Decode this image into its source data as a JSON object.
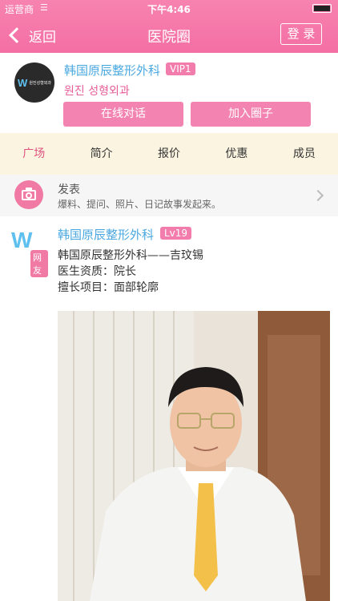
{
  "status_bar": {
    "carrier": "运营商",
    "time": "下午4:46"
  },
  "nav": {
    "back_label": "返回",
    "title": "医院圈",
    "login_label": "登 录"
  },
  "hospital": {
    "name": "韩国原辰整形外科",
    "vip_badge": "VIP1",
    "subtitle": "원진 성형외과",
    "logo_text": "W",
    "logo_small": "원진성형외과",
    "chat_button": "在线对话",
    "join_button": "加入圈子"
  },
  "tabs": [
    {
      "label": "广场",
      "active": true
    },
    {
      "label": "简介"
    },
    {
      "label": "报价"
    },
    {
      "label": "优惠"
    },
    {
      "label": "成员"
    }
  ],
  "compose": {
    "title": "发表",
    "hint": "爆料、提问、照片、日记故事发起来。"
  },
  "post": {
    "user": "韩国原辰整形外科",
    "level": "Lv19",
    "avatar_text": "W",
    "avatar_badge": "网友",
    "line1": "韩国原辰整形外科——吉玟锡",
    "line2": "医生资质：院长",
    "line3": "擅长项目：面部轮廓"
  },
  "colors": {
    "brand_pink": "#f46fa4",
    "link_blue": "#4aa8e0",
    "tab_bg": "#fbf4e1"
  }
}
